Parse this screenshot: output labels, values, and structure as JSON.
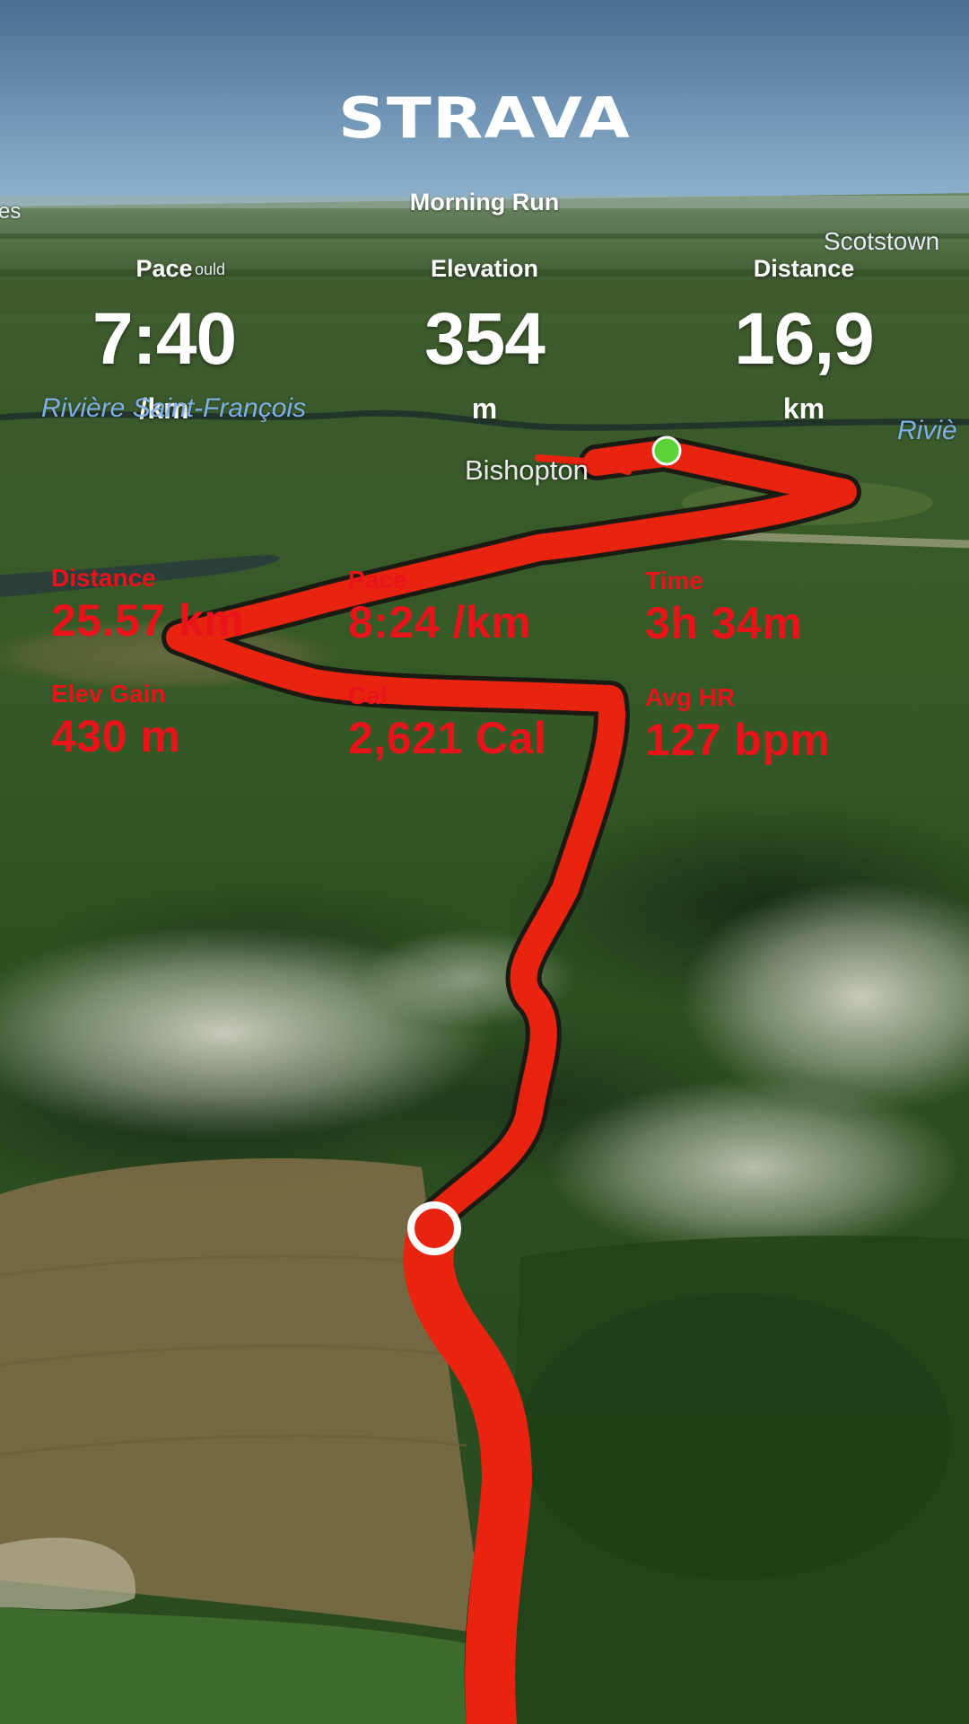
{
  "app": {
    "logo_text": "STRAVA"
  },
  "activity": {
    "title": "Morning Run"
  },
  "stats": [
    {
      "label": "Pace",
      "value": "7:40",
      "unit": "/km"
    },
    {
      "label": "Elevation",
      "value": "354",
      "unit": "m"
    },
    {
      "label": "Distance",
      "value": "16,9",
      "unit": "km"
    }
  ],
  "map": {
    "labels": {
      "scotstown": "Scotstown",
      "bishopton": "Bishopton",
      "riviere_saint_francois": "Rivière Saint-François",
      "riviere_right": "Riviè",
      "left_edge": "es",
      "ould": "ould"
    },
    "route_color": "#e8230f",
    "start_marker_color": "#5bd235"
  },
  "overlay_stats": [
    {
      "label": "Distance",
      "value": "25.57 km"
    },
    {
      "label": "Pace",
      "value": "8:24 /km"
    },
    {
      "label": "Time",
      "value": "3h 34m"
    },
    {
      "label": "Elev Gain",
      "value": "430 m"
    },
    {
      "label": "Cal",
      "value": "2,621 Cal"
    },
    {
      "label": "Avg HR",
      "value": "127 bpm"
    }
  ],
  "colors": {
    "overlay_text": "#e8141a",
    "sky_top": "#4d7196",
    "sky_bottom": "#8fb3cf"
  }
}
